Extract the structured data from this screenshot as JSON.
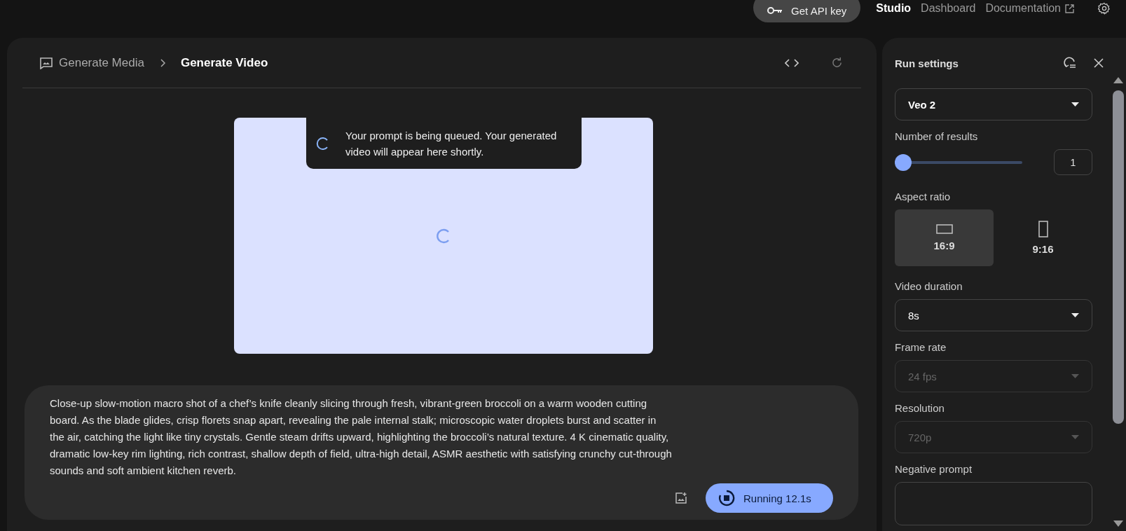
{
  "top_bar": {
    "api_button": "Get API key",
    "nav": [
      {
        "label": "Studio",
        "selected": true
      },
      {
        "label": "Dashboard",
        "selected": false
      },
      {
        "label": "Documentation",
        "selected": false,
        "external": true
      }
    ]
  },
  "breadcrumb": {
    "parent": "Generate Media",
    "current": "Generate Video"
  },
  "preview": {
    "toast": "Your prompt is being queued. Your generated video will appear here shortly."
  },
  "prompt": {
    "value": "Close-up slow-motion macro shot of a chef’s knife cleanly slicing through fresh, vibrant-green broccoli on a warm wooden cutting board. As the blade glides, crisp florets snap apart, revealing the pale internal stalk; microscopic water droplets burst and scatter in the air, catching the light like tiny crystals. Gentle steam drifts upward, highlighting the broccoli’s natural texture. 4 K cinematic quality, dramatic low-key rim lighting, rich contrast, shallow depth of field, ultra-high detail, ASMR aesthetic with satisfying crunchy cut-through sounds and soft ambient kitchen reverb.",
    "run_button": "Running 12.1s"
  },
  "run_settings": {
    "title": "Run settings",
    "model": {
      "value": "Veo 2",
      "disabled": false
    },
    "number_of_results": {
      "label": "Number of results",
      "level": 0,
      "value": "1"
    },
    "aspect_ratio": {
      "label": "Aspect ratio",
      "options": [
        {
          "label": "16:9",
          "kind": "landscape",
          "selected": true
        },
        {
          "label": "9:16",
          "kind": "portrait",
          "selected": false
        }
      ]
    },
    "dropdowns": [
      {
        "label": "Video duration",
        "value": "8s",
        "disabled": false
      },
      {
        "label": "Frame rate",
        "value": "24 fps",
        "disabled": true
      },
      {
        "label": "Resolution",
        "value": "720p",
        "disabled": true
      }
    ],
    "negative_prompt": {
      "label": "Negative prompt"
    }
  }
}
